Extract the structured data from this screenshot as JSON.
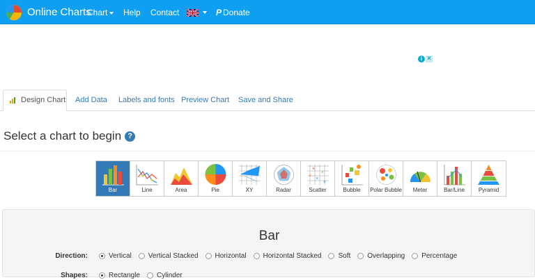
{
  "navbar": {
    "brand": "Online Charts",
    "menu": [
      {
        "label": "Chart",
        "dropdown": true
      },
      {
        "label": "Help"
      },
      {
        "label": "Contact"
      }
    ],
    "language_flag": "uk-flag-icon",
    "donate": "Donate",
    "colors": {
      "bar": "#0f9ff0"
    }
  },
  "tabs": [
    {
      "label": "Design Chart",
      "active": true,
      "icon": "bar-chart-icon"
    },
    {
      "label": "Add Data"
    },
    {
      "label": "Labels and fonts"
    },
    {
      "label": "Preview Chart"
    },
    {
      "label": "Save and Share"
    }
  ],
  "heading": "Select a chart to begin",
  "chart_types": [
    {
      "label": "Bar",
      "selected": true
    },
    {
      "label": "Line"
    },
    {
      "label": "Area"
    },
    {
      "label": "Pie"
    },
    {
      "label": "XY"
    },
    {
      "label": "Radar"
    },
    {
      "label": "Scatter"
    },
    {
      "label": "Bubble"
    },
    {
      "label": "Polar Bubble"
    },
    {
      "label": "Meter"
    },
    {
      "label": "Bar/Line"
    },
    {
      "label": "Pyramid"
    }
  ],
  "panel": {
    "title": "Bar",
    "options": [
      {
        "label": "Direction:",
        "choices": [
          "Vertical",
          "Vertical Stacked",
          "Horizontal",
          "Horizontal Stacked",
          "Soft",
          "Overlapping",
          "Percentage"
        ],
        "selected": "Vertical"
      },
      {
        "label": "Shapes:",
        "choices": [
          "Rectangle",
          "Cylinder"
        ],
        "selected": "Rectangle"
      }
    ]
  }
}
